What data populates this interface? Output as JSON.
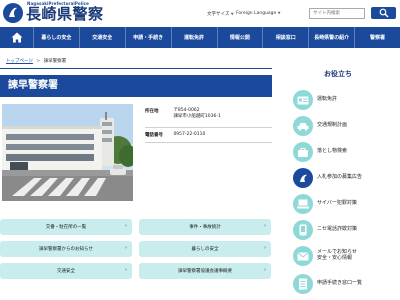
{
  "header": {
    "logo_en": "NagasakiPrefecturalPolice",
    "logo_jp": "長崎県警察",
    "font_size_label": "文字サイズ",
    "language_label": "Foreign Language",
    "search_placeholder": "サイト内検索"
  },
  "nav": {
    "items": [
      {
        "label": "暮らしの安全"
      },
      {
        "label": "交通安全"
      },
      {
        "label": "申請・手続き"
      },
      {
        "label": "運転免許"
      },
      {
        "label": "情報公開"
      },
      {
        "label": "相談窓口"
      },
      {
        "label": "長崎県警の紹介"
      },
      {
        "label": "警察署"
      }
    ]
  },
  "breadcrumb": {
    "home": "トップページ",
    "separator": ">",
    "current": "諫早警察署"
  },
  "page": {
    "title": "諫早警察署"
  },
  "info": {
    "location_label": "所在地",
    "postal": "〒854-0062",
    "address": "諫早市小船越町1036-1",
    "phone_label": "電話番号",
    "phone": "0957-22-0110"
  },
  "links": [
    {
      "label": "交番・駐在所の一覧"
    },
    {
      "label": "事件・事故統計"
    },
    {
      "label": "諫早警察署からのお知らせ"
    },
    {
      "label": "暮らしの安全"
    },
    {
      "label": "交通安全"
    },
    {
      "label": "諫早警察署協議会議事概要"
    }
  ],
  "sidebar": {
    "title": "お役立ち",
    "items": [
      {
        "label": "運転免許",
        "icon": "license-icon"
      },
      {
        "label": "交通規制計画",
        "icon": "car-icon"
      },
      {
        "label": "落とし物検索",
        "icon": "lost-item-icon"
      },
      {
        "label": "入札参加の募集広告",
        "icon": "bid-icon"
      },
      {
        "label": "サイバー犯罪対策",
        "icon": "cyber-icon"
      },
      {
        "label": "ニセ電話詐欺対策",
        "icon": "phone-scam-icon"
      },
      {
        "label": "メールでお知らせ",
        "label2": "安全・安心情報",
        "icon": "mail-icon"
      },
      {
        "label": "申請手続き窓口一覧",
        "icon": "document-icon"
      }
    ]
  },
  "colors": {
    "brand_blue": "#1b4a9c",
    "link_button_bg": "#c9ecec",
    "side_icon_bg": "#8fd8d8"
  }
}
